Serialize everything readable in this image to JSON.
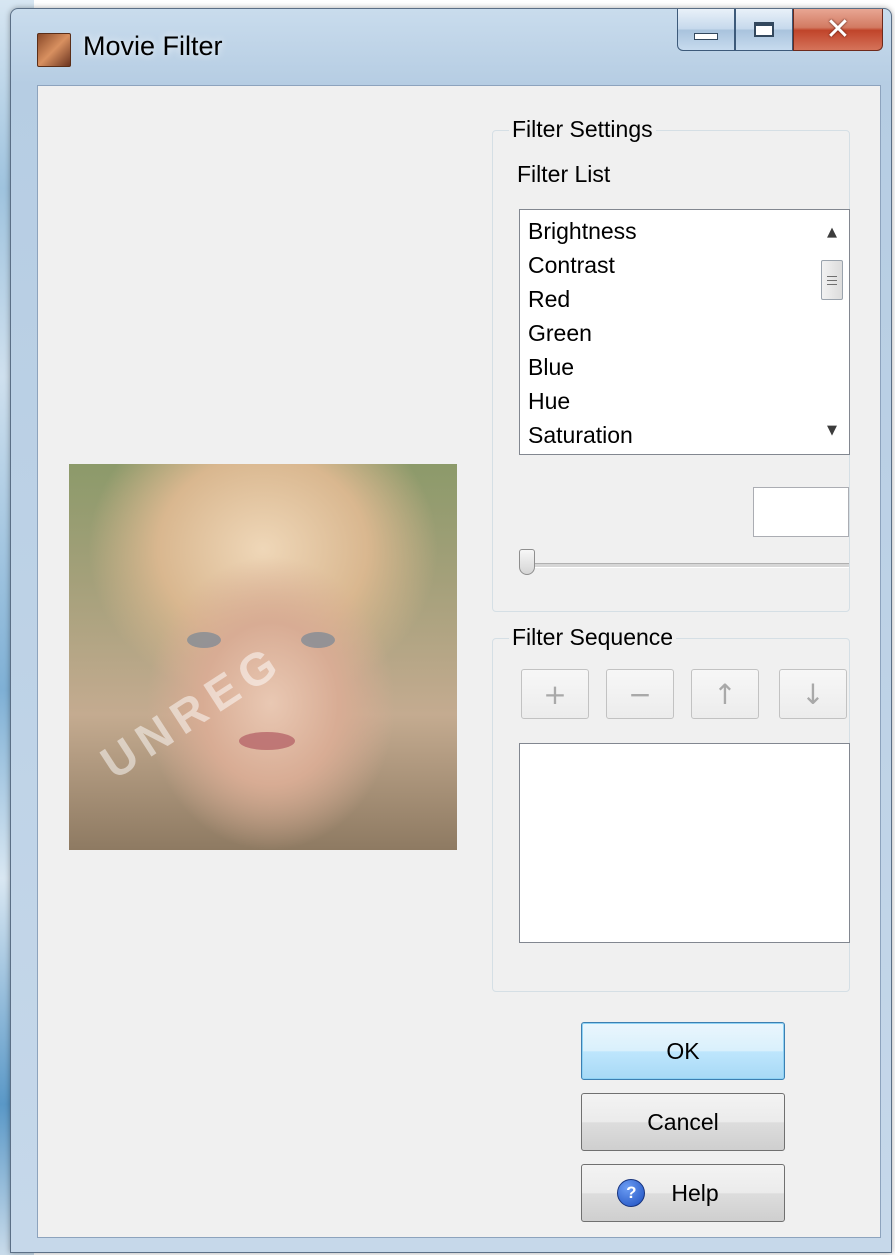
{
  "window": {
    "title": "Movie Filter",
    "icon": "app-movie-icon",
    "controls": {
      "minimize": "minimize-icon",
      "maximize": "maximize-icon",
      "close": "✕"
    }
  },
  "preview": {
    "watermark": "UNREG"
  },
  "filter_settings": {
    "group_title": "Filter Settings",
    "list_label": "Filter List",
    "filters": [
      "Brightness",
      "Contrast",
      "Red",
      "Green",
      "Blue",
      "Hue",
      "Saturation"
    ],
    "value": "",
    "slider_fraction": 0
  },
  "filter_sequence": {
    "group_title": "Filter Sequence",
    "buttons": {
      "add": "+",
      "remove": "−",
      "up": "↑",
      "down": "↓"
    },
    "items": []
  },
  "buttons": {
    "ok": "OK",
    "cancel": "Cancel",
    "help": "Help",
    "help_icon": "?"
  },
  "colors": {
    "default_button": "#bee6fd",
    "close_button": "#c0442a",
    "dialog_bg": "#f0f0f0"
  }
}
